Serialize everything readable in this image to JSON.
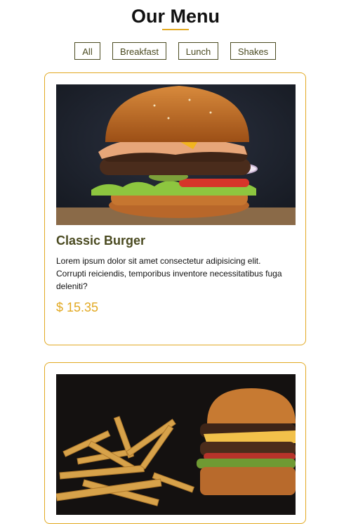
{
  "header": {
    "title": "Our Menu"
  },
  "filters": [
    "All",
    "Breakfast",
    "Lunch",
    "Shakes"
  ],
  "items": [
    {
      "title": "Classic Burger",
      "description": "Lorem ipsum dolor sit amet consectetur adipisicing elit. Corrupti reiciendis, temporibus inventore necessitatibus fuga deleniti?",
      "price": "$ 15.35",
      "image": "burger-photo"
    },
    {
      "image": "burger-with-fries-photo"
    }
  ],
  "colors": {
    "accent": "#e2a922",
    "heading": "#4a4a20"
  }
}
